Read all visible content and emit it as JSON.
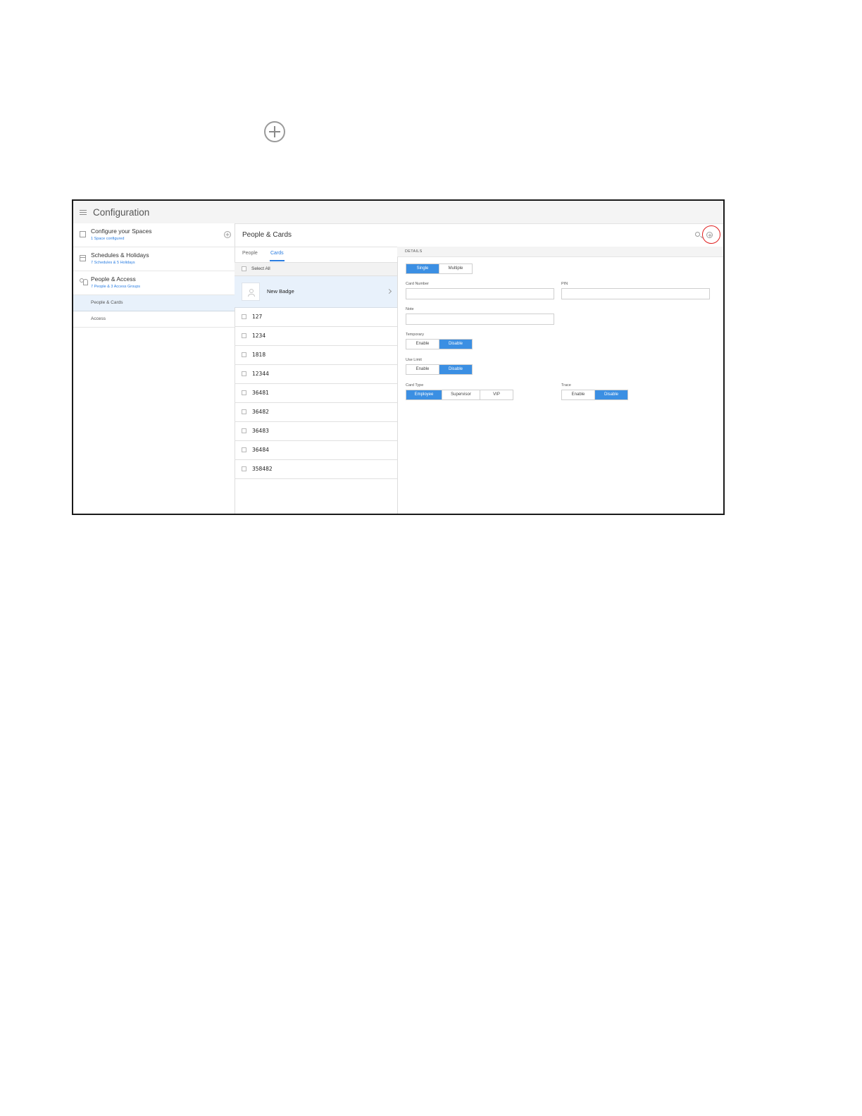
{
  "app": {
    "title": "Configuration"
  },
  "sidebar": {
    "items": [
      {
        "title": "Configure your Spaces",
        "subtitle": "1 Space configured"
      },
      {
        "title": "Schedules & Holidays",
        "subtitle": "7 Schedules & 5 Holidays"
      },
      {
        "title": "People & Access",
        "subtitle": "7 People & 3 Access Groups"
      }
    ],
    "sub_items": [
      "People & Cards",
      "Access"
    ]
  },
  "main": {
    "title": "People & Cards"
  },
  "tabs": [
    "People",
    "Cards"
  ],
  "list": {
    "select_all": "Select All",
    "new_item": "New Badge",
    "cards": [
      "127",
      "1234",
      "1818",
      "12344",
      "36481",
      "36482",
      "36483",
      "36484",
      "358482"
    ]
  },
  "details": {
    "header": "DETAILS",
    "mode_options": [
      "Single",
      "Multiple"
    ],
    "card_number_label": "Card Number",
    "pin_label": "PIN",
    "note_label": "Note",
    "temporary_label": "Temporary",
    "use_limit_label": "Use Limit",
    "card_type_label": "Card Type",
    "trace_label": "Trace",
    "enable": "Enable",
    "disable": "Disable",
    "card_type_options": [
      "Employee",
      "Supervisor",
      "VIP"
    ]
  },
  "colors": {
    "accent": "#3b8fe3",
    "highlight": "#e02020",
    "selected_bg": "#e8f1fb"
  }
}
